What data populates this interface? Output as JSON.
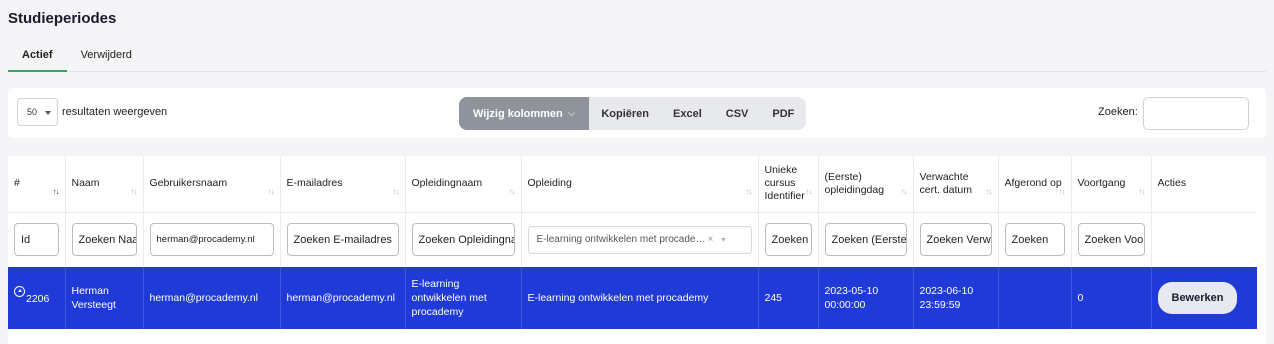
{
  "page": {
    "title": "Studieperiodes"
  },
  "tabs": [
    {
      "label": "Actief",
      "active": true
    },
    {
      "label": "Verwijderd",
      "active": false
    }
  ],
  "toolbar": {
    "page_length": "50",
    "page_length_label": "resultaten weergeven",
    "buttons": {
      "columns": "Wijzig kolommen",
      "copy": "Kopiëren",
      "excel": "Excel",
      "csv": "CSV",
      "pdf": "PDF"
    },
    "search_label": "Zoeken:",
    "search_value": ""
  },
  "table": {
    "headers": [
      "#",
      "Naam",
      "Gebruikersnaam",
      "E-mailadres",
      "Opleidingnaam",
      "Opleiding",
      "Unieke cursus Identifier",
      "(Eerste) opleidingdag",
      "Verwachte cert. datum",
      "Afgerond op",
      "Voortgang",
      "Acties"
    ],
    "filters": {
      "id": "Id",
      "naam": "Zoeken Naam",
      "gebruikersnaam": "herman@procademy.nl",
      "email": "Zoeken E-mailadres",
      "opleidingnaam": "Zoeken Opleidingnaam",
      "opleiding": "E-learning ontwikkelen met procade…",
      "identifier": "Zoeken",
      "eerste_dag": "Zoeken (Eerste)",
      "cert_datum": "Zoeken Verwachte",
      "afgerond": "Zoeken",
      "voortgang": "Zoeken Voortgang"
    },
    "rows": [
      {
        "id": "2206",
        "naam": "Herman Versteegt",
        "gebruikersnaam": "herman@procademy.nl",
        "email": "herman@procademy.nl",
        "opleidingnaam": "E-learning ontwikkelen met procademy",
        "opleiding": "E-learning ontwikkelen met procademy",
        "identifier": "245",
        "eerste_dag": "2023-05-10 00:00:00",
        "cert_datum": "2023-06-10 23:59:59",
        "afgerond": "",
        "voortgang": "0",
        "action_label": "Bewerken"
      }
    ]
  },
  "colors": {
    "accent": "#2ea56b",
    "selected_row": "#1f3ad6",
    "button_dark": "#8f949c"
  }
}
